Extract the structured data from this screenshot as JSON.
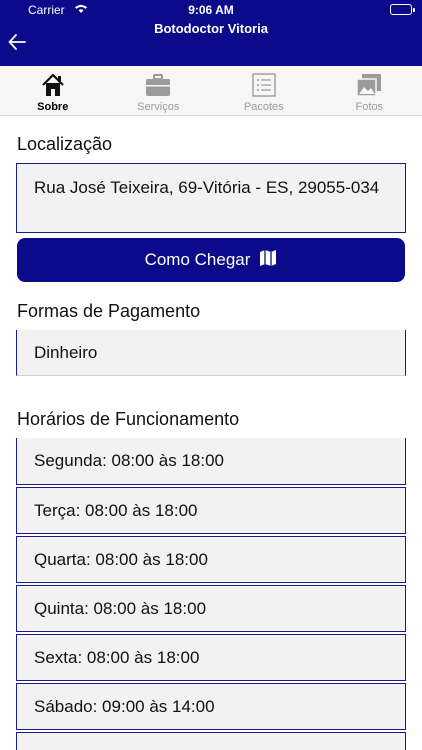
{
  "status_bar": {
    "carrier": "Carrier",
    "time": "9:06 AM"
  },
  "header": {
    "title": "Botodoctor Vitoria",
    "back_icon": "back-arrow-icon"
  },
  "tabs": [
    {
      "label": "Sobre",
      "icon": "home-icon",
      "active": true
    },
    {
      "label": "Serviços",
      "icon": "briefcase-icon",
      "active": false
    },
    {
      "label": "Pacotes",
      "icon": "list-icon",
      "active": false
    },
    {
      "label": "Fotos",
      "icon": "photos-icon",
      "active": false
    }
  ],
  "location": {
    "title": "Localização",
    "address": "Rua José Teixeira, 69-Vitória - ES, 29055-034",
    "directions_label": "Como Chegar",
    "directions_icon": "map-icon"
  },
  "payment": {
    "title": "Formas de Pagamento",
    "methods": [
      "Dinheiro"
    ]
  },
  "hours": {
    "title": "Horários de Funcionamento",
    "days": [
      "Segunda: 08:00 às 18:00",
      "Terça: 08:00 às 18:00",
      "Quarta: 08:00 às 18:00",
      "Quinta: 08:00 às 18:00",
      "Sexta: 08:00 às 18:00",
      "Sábado: 09:00 às 14:00",
      ""
    ]
  },
  "colors": {
    "primary": "#0b0a8a",
    "field_bg": "#f2f2f2",
    "tab_bg": "#f6f6f6",
    "inactive_tab": "#9b9b9b"
  }
}
